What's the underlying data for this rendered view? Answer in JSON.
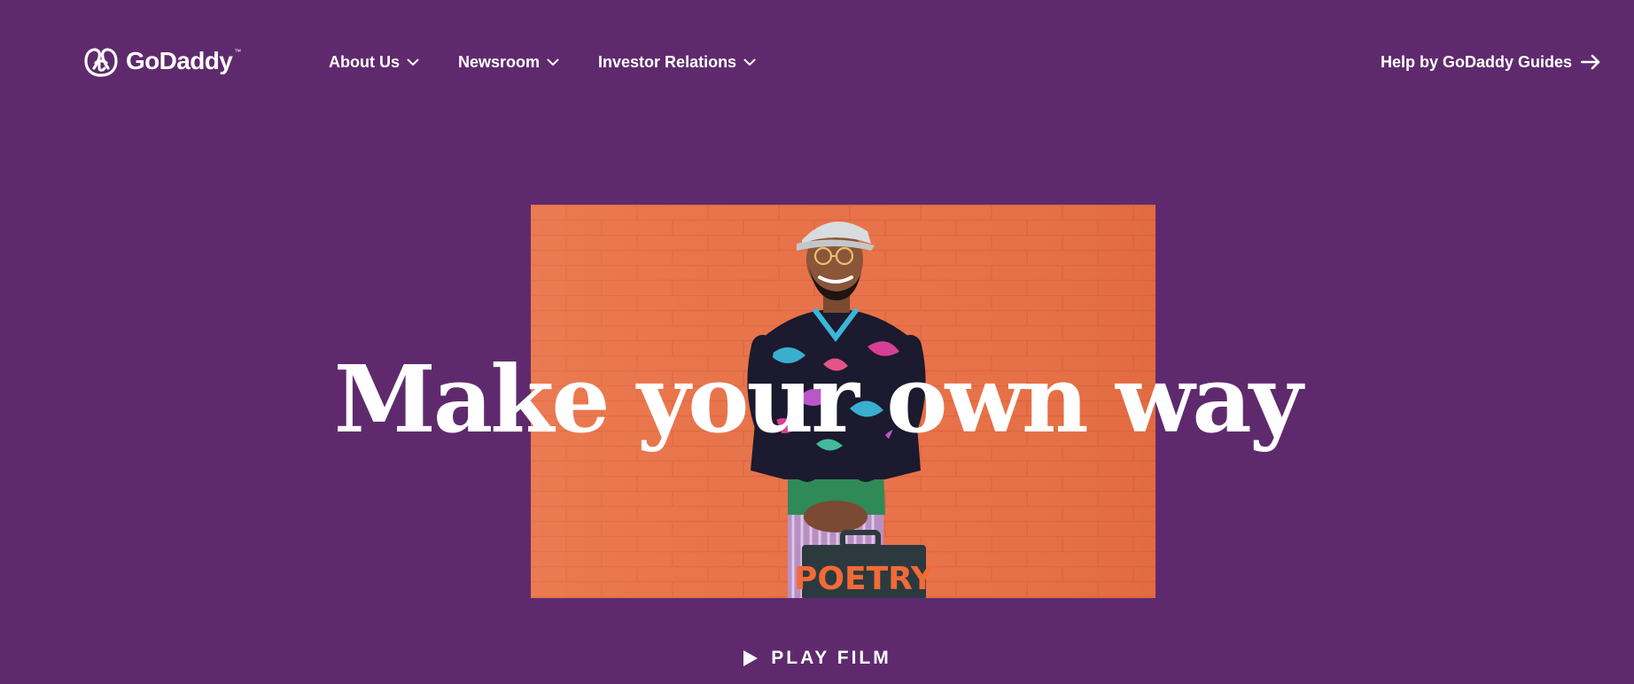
{
  "brand": {
    "name": "GoDaddy",
    "trademark": "™"
  },
  "nav": {
    "items": [
      {
        "label": "About Us"
      },
      {
        "label": "Newsroom"
      },
      {
        "label": "Investor Relations"
      }
    ]
  },
  "help_link": {
    "label": "Help by GoDaddy Guides"
  },
  "hero": {
    "headline": "Make your own way",
    "suitcase_text": "POETRY",
    "play_label": "PLAY FILM"
  },
  "colors": {
    "background": "#5f2a6d",
    "text": "#ffffff",
    "hero_wall": "#e8734a"
  },
  "icons": {
    "logo": "godaddy-logo-icon",
    "dropdown": "chevron-down-icon",
    "help": "arrow-right-icon",
    "play": "play-icon"
  }
}
